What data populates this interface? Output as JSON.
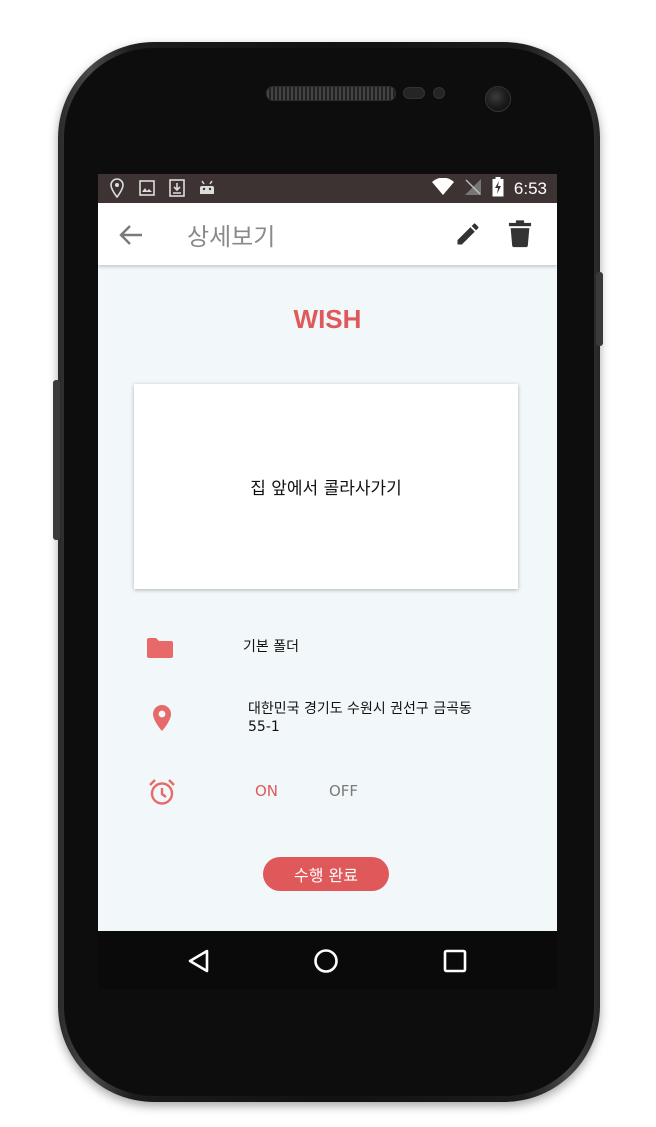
{
  "status_bar": {
    "time": "6:53",
    "left_icons": [
      "location-icon",
      "image-icon",
      "download-icon",
      "android-icon"
    ],
    "right_icons": [
      "wifi-icon",
      "no-signal-icon",
      "battery-charging-icon"
    ]
  },
  "app_bar": {
    "title": "상세보기",
    "back_icon": "arrow-left-icon",
    "actions": [
      "pencil-icon",
      "trash-icon"
    ]
  },
  "detail": {
    "category": "WISH",
    "content": "집 앞에서 콜라사가기",
    "folder": "기본 폴더",
    "address": "대한민국 경기도 수원시 권선구 금곡동 55-1",
    "alarm_on": "ON",
    "alarm_off": "OFF",
    "complete_label": "수행 완료"
  },
  "colors": {
    "accent": "#e0595a",
    "background": "#f2f8fa",
    "status_bar": "#3d3333"
  },
  "nav_bar": [
    "back-triangle-icon",
    "home-circle-icon",
    "recent-square-icon"
  ]
}
